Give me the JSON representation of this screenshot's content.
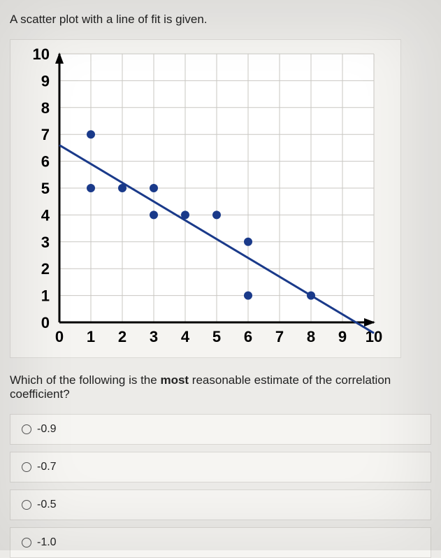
{
  "intro_text": "A scatter plot with a line of fit is given.",
  "question_prefix": "Which of the following is the ",
  "question_bold": "most",
  "question_suffix": " reasonable estimate of the correlation coefficient?",
  "options": [
    {
      "label": "-0.9"
    },
    {
      "label": "-0.7"
    },
    {
      "label": "-0.5"
    },
    {
      "label": "-1.0"
    }
  ],
  "chart_data": {
    "type": "scatter",
    "title": "",
    "xlabel": "",
    "ylabel": "",
    "xlim": [
      0,
      10
    ],
    "ylim": [
      0,
      10
    ],
    "x_ticks": [
      0,
      1,
      2,
      3,
      4,
      5,
      6,
      7,
      8,
      9,
      10
    ],
    "y_ticks": [
      0,
      1,
      2,
      3,
      4,
      5,
      6,
      7,
      8,
      9,
      10
    ],
    "series": [
      {
        "name": "points",
        "x": [
          1,
          1,
          2,
          3,
          3,
          4,
          5,
          6,
          6,
          8
        ],
        "y": [
          7,
          5,
          5,
          5,
          4,
          4,
          4,
          3,
          1,
          1
        ]
      }
    ],
    "fit_line": {
      "x": [
        0,
        10
      ],
      "y": [
        6.6,
        -0.4
      ]
    },
    "grid": true
  }
}
